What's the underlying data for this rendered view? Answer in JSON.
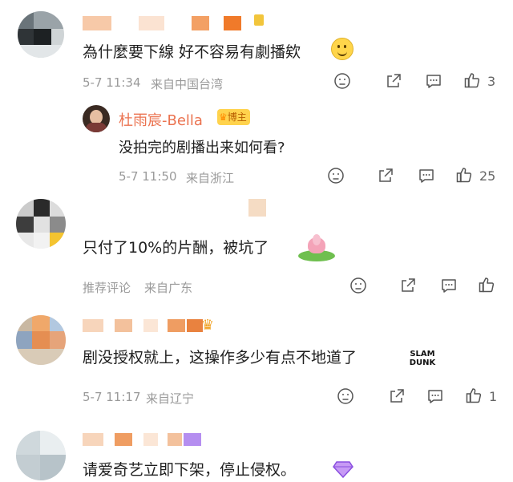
{
  "comments": [
    {
      "text": "為什麼要下線 好不容易有劇播欸",
      "time": "5-7 11:34",
      "location": "来自中国台湾",
      "likes": "3",
      "reply": {
        "username": "杜雨宸-Bella",
        "badge": "博主",
        "text": "没拍完的剧播出来如何看?",
        "time": "5-7 11:50",
        "location": "来自浙江",
        "likes": "25"
      }
    },
    {
      "text": "只付了10%的片酬，被坑了",
      "time": "推荐评论",
      "location": "来自广东",
      "likes": ""
    },
    {
      "text": "剧没授权就上，这操作多少有点不地道了",
      "sticker_text": "SLAM DUNK",
      "time": "5-7 11:17",
      "location": "来自辽宁",
      "likes": "1"
    },
    {
      "text": "请爱奇艺立即下架，停止侵权。"
    }
  ],
  "icons": [
    "dislike-icon",
    "share-icon",
    "comment-icon",
    "like-icon"
  ]
}
